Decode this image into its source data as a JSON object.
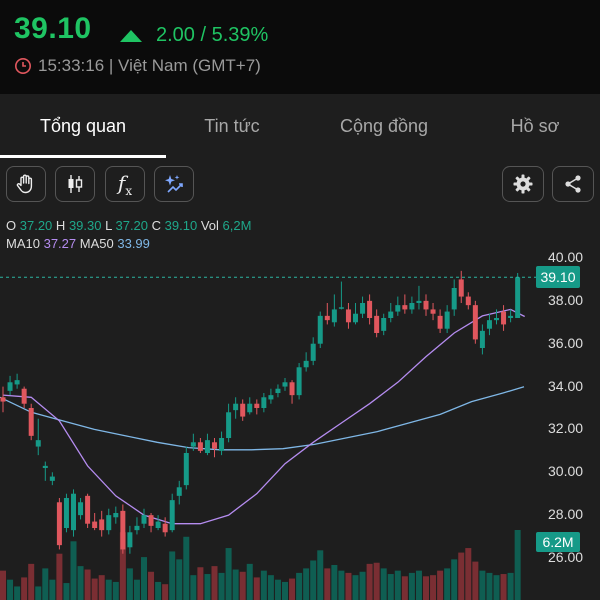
{
  "header": {
    "price": "39.10",
    "change": "2.00 / 5.39%",
    "time_text": "15:33:16 | Việt Nam (GMT+7)",
    "up_color": "#1fc463",
    "clock_icon": "clock-icon"
  },
  "tabs": [
    {
      "label": "Tổng quan",
      "active": true
    },
    {
      "label": "Tin tức",
      "active": false
    },
    {
      "label": "Cộng đồng",
      "active": false
    },
    {
      "label": "Hồ sơ",
      "active": false
    }
  ],
  "toolbar": {
    "left_tools": [
      "hand-icon",
      "candlestick-icon",
      "function-icon",
      "ai-sparkle-icon"
    ],
    "fx_label": "f",
    "fx_sub": "x",
    "right_tools": [
      "gear-icon",
      "share-icon"
    ]
  },
  "legend": {
    "o_label": "O",
    "o_value": "37.20",
    "h_label": "H",
    "h_value": "39.30",
    "l_label": "L",
    "l_value": "37.20",
    "c_label": "C",
    "c_value": "39.10",
    "vol_label": "Vol",
    "vol_value": "6,2M",
    "ma10_label": "MA10",
    "ma10_value": "37.27",
    "ma50_label": "MA50",
    "ma50_value": "33.99"
  },
  "chart_data": {
    "type": "candlestick",
    "y_ticks": [
      "40.00",
      "38.00",
      "36.00",
      "34.00",
      "32.00",
      "30.00",
      "28.00",
      "26.00"
    ],
    "ylim": [
      25.0,
      40.6
    ],
    "current_price_label": "39.10",
    "current_price": 39.1,
    "volume_label": "6.2M",
    "up_color": "#169a88",
    "down_color": "#e0575e",
    "ma10_color": "#b58cf0",
    "ma50_color": "#7fb7e6",
    "candles": [
      [
        33.5,
        33.3,
        34.0,
        32.8
      ],
      [
        33.8,
        34.2,
        34.5,
        33.6
      ],
      [
        34.1,
        34.3,
        34.6,
        33.9
      ],
      [
        33.9,
        33.2,
        34.0,
        33.0
      ],
      [
        33.0,
        31.7,
        33.2,
        31.5
      ],
      [
        31.2,
        31.5,
        32.5,
        30.8
      ],
      [
        30.2,
        30.3,
        30.5,
        29.6
      ],
      [
        29.6,
        29.8,
        30.0,
        29.4
      ],
      [
        28.6,
        26.6,
        28.8,
        26.4
      ],
      [
        27.4,
        28.8,
        29.0,
        27.2
      ],
      [
        27.3,
        29.0,
        29.2,
        27.0
      ],
      [
        28.0,
        28.6,
        28.8,
        27.8
      ],
      [
        28.9,
        27.6,
        29.0,
        27.4
      ],
      [
        27.7,
        27.4,
        28.1,
        27.3
      ],
      [
        27.8,
        27.3,
        28.2,
        27.0
      ],
      [
        27.3,
        28.0,
        28.3,
        27.1
      ],
      [
        27.9,
        28.1,
        28.4,
        27.6
      ],
      [
        28.2,
        26.4,
        28.5,
        26.2
      ],
      [
        26.5,
        27.2,
        27.5,
        26.2
      ],
      [
        27.3,
        27.5,
        27.9,
        27.1
      ],
      [
        27.6,
        28.0,
        28.3,
        27.4
      ],
      [
        28.0,
        27.5,
        28.1,
        27.2
      ],
      [
        27.4,
        27.7,
        28.0,
        27.3
      ],
      [
        27.6,
        27.2,
        27.9,
        27.0
      ],
      [
        27.3,
        28.7,
        29.0,
        27.2
      ],
      [
        28.9,
        29.3,
        29.6,
        28.5
      ],
      [
        29.4,
        30.9,
        31.2,
        29.2
      ],
      [
        31.2,
        31.4,
        31.8,
        31.0
      ],
      [
        31.4,
        31.0,
        31.6,
        30.9
      ],
      [
        30.9,
        31.5,
        31.8,
        30.8
      ],
      [
        31.4,
        31.1,
        31.6,
        30.7
      ],
      [
        31.0,
        31.6,
        31.9,
        30.8
      ],
      [
        31.6,
        32.8,
        33.2,
        31.4
      ],
      [
        32.9,
        33.2,
        33.5,
        32.5
      ],
      [
        33.2,
        32.6,
        33.4,
        32.4
      ],
      [
        32.8,
        33.2,
        33.5,
        32.7
      ],
      [
        33.2,
        33.0,
        33.4,
        32.7
      ],
      [
        33.0,
        33.5,
        33.7,
        32.8
      ],
      [
        33.4,
        33.6,
        33.9,
        33.2
      ],
      [
        33.7,
        33.9,
        34.1,
        33.5
      ],
      [
        34.0,
        34.2,
        34.4,
        33.8
      ],
      [
        34.2,
        33.6,
        34.3,
        33.2
      ],
      [
        33.6,
        34.9,
        35.1,
        33.4
      ],
      [
        34.9,
        35.2,
        35.6,
        34.7
      ],
      [
        35.2,
        36.0,
        36.3,
        35.0
      ],
      [
        36.0,
        37.3,
        37.5,
        35.8
      ],
      [
        37.3,
        37.1,
        37.9,
        36.9
      ],
      [
        37.0,
        37.6,
        38.3,
        36.8
      ],
      [
        37.7,
        37.7,
        38.9,
        37.6
      ],
      [
        37.6,
        37.0,
        37.9,
        36.7
      ],
      [
        37.0,
        37.4,
        37.9,
        36.9
      ],
      [
        37.4,
        37.9,
        38.2,
        37.2
      ],
      [
        38.0,
        37.2,
        38.3,
        36.9
      ],
      [
        37.3,
        36.5,
        37.6,
        36.3
      ],
      [
        36.6,
        37.2,
        37.4,
        36.4
      ],
      [
        37.2,
        37.5,
        37.9,
        37.0
      ],
      [
        37.5,
        37.8,
        38.2,
        37.3
      ],
      [
        37.8,
        37.6,
        38.3,
        37.4
      ],
      [
        37.6,
        37.9,
        38.2,
        37.4
      ],
      [
        37.9,
        38.0,
        38.7,
        37.6
      ],
      [
        38.0,
        37.6,
        38.3,
        37.3
      ],
      [
        37.6,
        37.4,
        37.9,
        37.1
      ],
      [
        37.3,
        36.7,
        37.6,
        36.5
      ],
      [
        36.7,
        37.5,
        37.8,
        36.5
      ],
      [
        37.6,
        38.6,
        39.0,
        37.3
      ],
      [
        39.0,
        38.2,
        39.4,
        37.9
      ],
      [
        38.2,
        37.8,
        38.4,
        37.6
      ],
      [
        37.8,
        36.2,
        38.0,
        36.0
      ],
      [
        35.8,
        36.6,
        36.9,
        35.5
      ],
      [
        36.7,
        37.1,
        37.4,
        36.4
      ],
      [
        37.1,
        37.2,
        37.6,
        36.9
      ],
      [
        37.5,
        36.9,
        37.8,
        36.6
      ],
      [
        37.2,
        37.3,
        37.6,
        37.0
      ],
      [
        37.2,
        39.1,
        39.3,
        37.2
      ]
    ],
    "ma10": [
      [
        0,
        33.6
      ],
      [
        4,
        33.5
      ],
      [
        8,
        32.4
      ],
      [
        12,
        30.3
      ],
      [
        16,
        28.9
      ],
      [
        20,
        28.0
      ],
      [
        24,
        27.6
      ],
      [
        28,
        27.6
      ],
      [
        32,
        28.0
      ],
      [
        36,
        29.0
      ],
      [
        40,
        30.4
      ],
      [
        44,
        31.4
      ],
      [
        48,
        32.3
      ],
      [
        52,
        33.2
      ],
      [
        56,
        34.2
      ],
      [
        60,
        35.4
      ],
      [
        64,
        36.5
      ],
      [
        68,
        37.3
      ],
      [
        72,
        37.6
      ],
      [
        74,
        37.27
      ]
    ],
    "ma50": [
      [
        0,
        33.5
      ],
      [
        6,
        32.8
      ],
      [
        12,
        32.4
      ],
      [
        18,
        32.0
      ],
      [
        24,
        31.7
      ],
      [
        30,
        31.4
      ],
      [
        36,
        31.15
      ],
      [
        42,
        31.05
      ],
      [
        48,
        31.05
      ],
      [
        54,
        31.1
      ],
      [
        60,
        31.3
      ],
      [
        66,
        31.6
      ],
      [
        72,
        31.9
      ],
      [
        78,
        32.3
      ],
      [
        84,
        32.7
      ],
      [
        90,
        33.3
      ],
      [
        96,
        33.7
      ],
      [
        100,
        33.99
      ]
    ],
    "volumes": [
      2.6,
      1.8,
      1.2,
      2.0,
      3.2,
      1.2,
      2.8,
      1.8,
      4.1,
      1.5,
      5.2,
      3.0,
      2.7,
      1.9,
      2.2,
      1.8,
      1.6,
      6.0,
      2.8,
      1.8,
      3.8,
      2.5,
      1.6,
      1.4,
      4.3,
      3.6,
      5.6,
      2.2,
      2.9,
      2.3,
      3.0,
      2.4,
      4.6,
      2.7,
      2.5,
      3.2,
      2.0,
      2.6,
      2.2,
      1.8,
      1.6,
      1.9,
      2.4,
      2.8,
      3.5,
      4.4,
      2.8,
      3.1,
      2.6,
      2.4,
      2.2,
      2.5,
      3.2,
      3.3,
      2.8,
      2.3,
      2.6,
      2.1,
      2.4,
      2.6,
      2.1,
      2.2,
      2.6,
      2.8,
      3.6,
      4.2,
      4.6,
      3.4,
      2.6,
      2.4,
      2.2,
      2.3,
      2.4,
      6.2
    ]
  }
}
